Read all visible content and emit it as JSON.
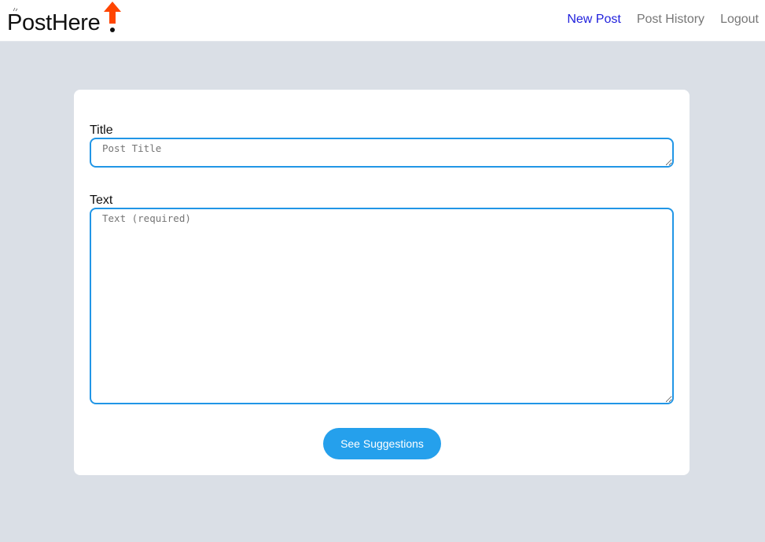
{
  "navbar": {
    "logo_text": "PostHere",
    "links": [
      {
        "label": "New Post",
        "active": true
      },
      {
        "label": "Post History",
        "active": false
      },
      {
        "label": "Logout",
        "active": false
      }
    ]
  },
  "form": {
    "title_label": "Title",
    "title_placeholder": "Post Title",
    "title_value": "",
    "text_label": "Text",
    "text_placeholder": "Text (required)",
    "text_value": "",
    "submit_label": "See Suggestions"
  },
  "colors": {
    "page_background": "#dadfe6",
    "accent": "#25a0ec",
    "input_border": "#2196e6",
    "active_link": "#1f1fdc",
    "logo_arrow": "#ff4500"
  }
}
